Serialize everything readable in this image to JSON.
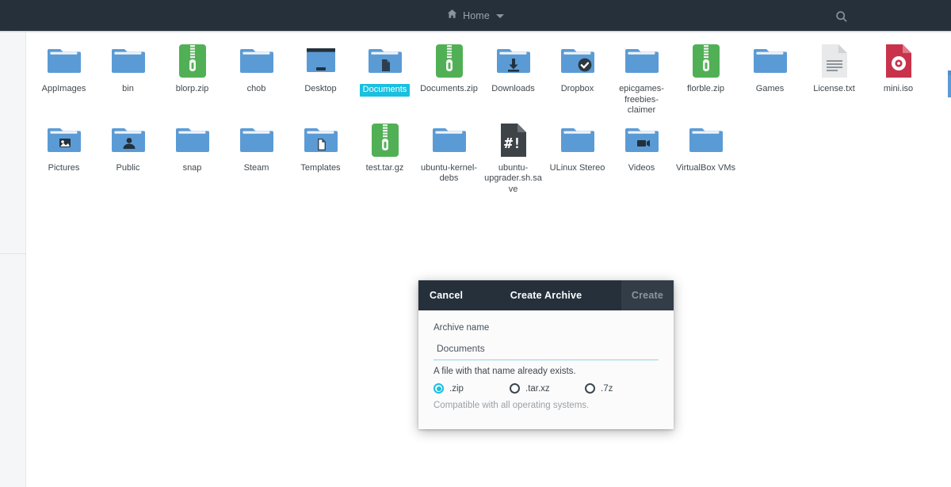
{
  "window": {
    "header": {
      "home_icon": "home-icon",
      "path_label": "Home",
      "dropdown_icon": "chevron-down-icon",
      "search_icon": "search-icon"
    },
    "accent_color": "#19c0e0",
    "header_bg": "#25303b",
    "folder_color": "#5b9bd5",
    "archive_color": "#51b055",
    "iso_color": "#c8334b"
  },
  "files": [
    {
      "name": "AppImages",
      "icon": "folder-icon",
      "type": "folder",
      "selected": false
    },
    {
      "name": "bin",
      "icon": "folder-icon",
      "type": "folder",
      "selected": false
    },
    {
      "name": "blorp.zip",
      "icon": "archive-icon",
      "type": "archive",
      "selected": false
    },
    {
      "name": "chob",
      "icon": "folder-icon",
      "type": "folder",
      "selected": false
    },
    {
      "name": "Desktop",
      "icon": "monitor-folder-icon",
      "type": "desktop",
      "selected": false
    },
    {
      "name": "Documents",
      "icon": "documents-folder-icon",
      "type": "folder-doc",
      "selected": true
    },
    {
      "name": "Documents.zip",
      "icon": "archive-icon",
      "type": "archive",
      "selected": false
    },
    {
      "name": "Downloads",
      "icon": "downloads-folder-icon",
      "type": "folder-dl",
      "selected": false
    },
    {
      "name": "Dropbox",
      "icon": "dropbox-folder-icon",
      "type": "folder-check",
      "selected": false
    },
    {
      "name": "epicgames-freebies-claimer",
      "icon": "folder-icon",
      "type": "folder",
      "selected": false
    },
    {
      "name": "florble.zip",
      "icon": "archive-icon",
      "type": "archive",
      "selected": false
    },
    {
      "name": "Games",
      "icon": "folder-icon",
      "type": "folder",
      "selected": false
    },
    {
      "name": "License.txt",
      "icon": "text-file-icon",
      "type": "text",
      "selected": false
    },
    {
      "name": "mini.iso",
      "icon": "disc-image-icon",
      "type": "iso",
      "selected": false
    },
    {
      "name": "Pictures",
      "icon": "pictures-folder-icon",
      "type": "folder-pic",
      "selected": false
    },
    {
      "name": "Public",
      "icon": "public-folder-icon",
      "type": "folder-pub",
      "selected": false
    },
    {
      "name": "snap",
      "icon": "folder-icon",
      "type": "folder",
      "selected": false
    },
    {
      "name": "Steam",
      "icon": "folder-icon",
      "type": "folder",
      "selected": false
    },
    {
      "name": "Templates",
      "icon": "templates-folder-icon",
      "type": "folder-tpl",
      "selected": false
    },
    {
      "name": "test.tar.gz",
      "icon": "archive-icon",
      "type": "archive",
      "selected": false
    },
    {
      "name": "ubuntu-kernel-debs",
      "icon": "folder-icon",
      "type": "folder",
      "selected": false
    },
    {
      "name": "ubuntu-upgrader.sh.save",
      "icon": "script-file-icon",
      "type": "script",
      "selected": false
    },
    {
      "name": "ULinux Stereo",
      "icon": "folder-icon",
      "type": "folder",
      "selected": false
    },
    {
      "name": "Videos",
      "icon": "videos-folder-icon",
      "type": "folder-vid",
      "selected": false
    },
    {
      "name": "VirtualBox VMs",
      "icon": "folder-icon",
      "type": "folder",
      "selected": false
    }
  ],
  "dialog": {
    "title": "Create Archive",
    "cancel_label": "Cancel",
    "create_label": "Create",
    "archive_name_label": "Archive name",
    "archive_name_value": "Documents",
    "archive_name_placeholder": "Archive name",
    "warning_text": "A file with that name already exists.",
    "format_options": [
      {
        "label": ".zip",
        "selected": true
      },
      {
        "label": ".tar.xz",
        "selected": false
      },
      {
        "label": ".7z",
        "selected": false
      }
    ],
    "format_hint": "Compatible with all operating systems."
  }
}
